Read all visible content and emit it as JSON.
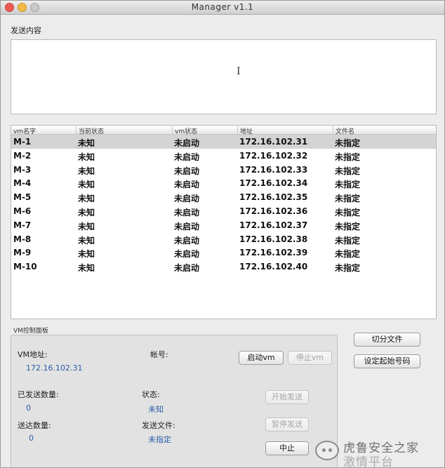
{
  "window": {
    "title": "Manager v1.1"
  },
  "send": {
    "label": "发送内容",
    "value": ""
  },
  "table": {
    "headers": [
      "vm名字",
      "当前状态",
      "vm状态",
      "地址",
      "文件名"
    ],
    "rows": [
      [
        "M-1",
        "未知",
        "未启动",
        "172.16.102.31",
        "未指定"
      ],
      [
        "M-2",
        "未知",
        "未启动",
        "172.16.102.32",
        "未指定"
      ],
      [
        "M-3",
        "未知",
        "未启动",
        "172.16.102.33",
        "未指定"
      ],
      [
        "M-4",
        "未知",
        "未启动",
        "172.16.102.34",
        "未指定"
      ],
      [
        "M-5",
        "未知",
        "未启动",
        "172.16.102.35",
        "未指定"
      ],
      [
        "M-6",
        "未知",
        "未启动",
        "172.16.102.36",
        "未指定"
      ],
      [
        "M-7",
        "未知",
        "未启动",
        "172.16.102.37",
        "未指定"
      ],
      [
        "M-8",
        "未知",
        "未启动",
        "172.16.102.38",
        "未指定"
      ],
      [
        "M-9",
        "未知",
        "未启动",
        "172.16.102.39",
        "未指定"
      ],
      [
        "M-10",
        "未知",
        "未启动",
        "172.16.102.40",
        "未指定"
      ]
    ]
  },
  "panel": {
    "title": "VM控制面板",
    "vm_address_label": "VM地址:",
    "vm_address_value": "172.16.102.31",
    "account_label": "帐号:",
    "start_vm": "启动vm",
    "stop_vm": "停止vm",
    "sent_count_label": "已发送数量:",
    "sent_count_value": "0",
    "status_label": "状态:",
    "status_value": "未知",
    "start_send": "开始发送",
    "delivered_label": "送达数量:",
    "delivered_value": "0",
    "send_file_label": "发送文件:",
    "send_file_value": "未指定",
    "pause_send": "暂停发送",
    "abort": "中止"
  },
  "side_buttons": {
    "split_file": "切分文件",
    "set_start_number": "设定起始号码"
  },
  "watermark": {
    "line1": "虎鲁安全之家",
    "line2": "激情平台"
  },
  "colors": {
    "value_text": "#2a5ca8",
    "selected_row": "#d4d4d4"
  }
}
